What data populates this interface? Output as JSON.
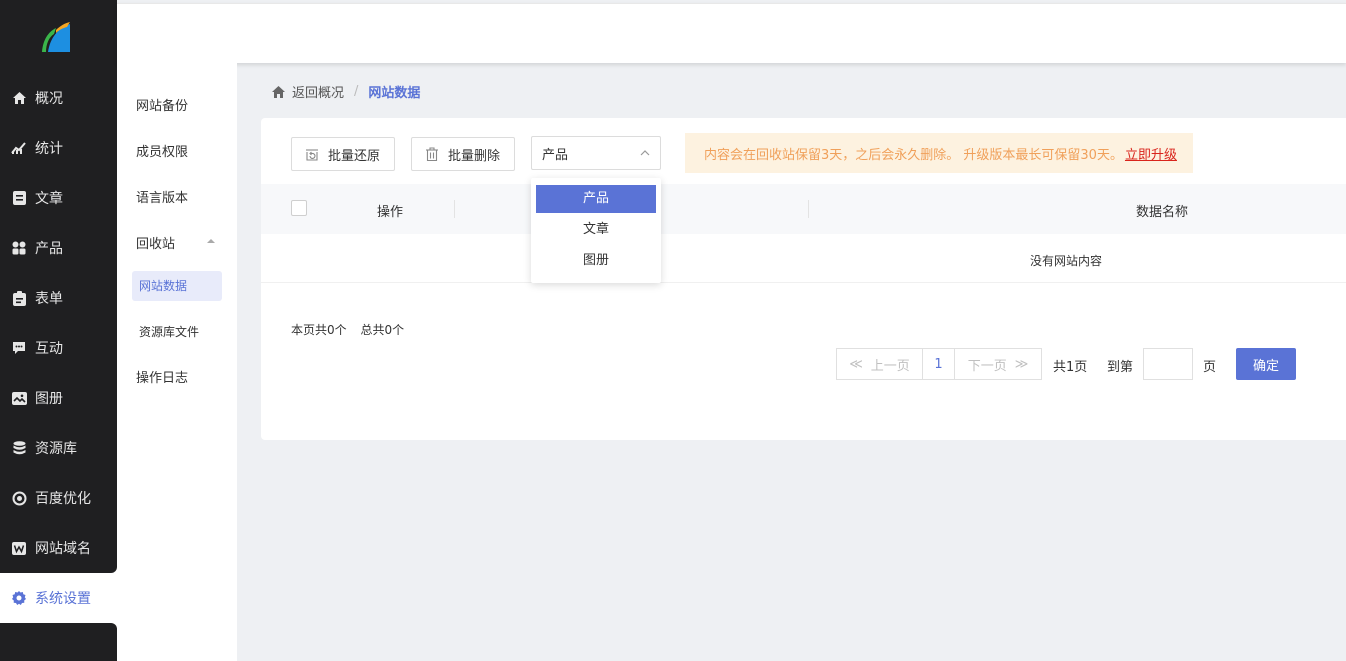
{
  "sidebar": {
    "items": [
      {
        "label": "概况",
        "icon": "home-icon"
      },
      {
        "label": "统计",
        "icon": "chart-icon"
      },
      {
        "label": "文章",
        "icon": "article-icon"
      },
      {
        "label": "产品",
        "icon": "grid-icon"
      },
      {
        "label": "表单",
        "icon": "clipboard-icon"
      },
      {
        "label": "互动",
        "icon": "chat-icon"
      },
      {
        "label": "图册",
        "icon": "image-icon"
      },
      {
        "label": "资源库",
        "icon": "database-icon"
      },
      {
        "label": "百度优化",
        "icon": "target-icon"
      },
      {
        "label": "网站域名",
        "icon": "w-icon"
      },
      {
        "label": "系统设置",
        "icon": "gear-icon",
        "active": true
      }
    ]
  },
  "subnav": {
    "items": [
      "网站备份",
      "成员权限",
      "语言版本",
      "回收站"
    ],
    "children": [
      "网站数据",
      "资源库文件"
    ],
    "last": "操作日志"
  },
  "breadcrumb": {
    "back": "返回概况",
    "sep": "/",
    "current": "网站数据"
  },
  "toolbar": {
    "restore_label": "批量还原",
    "delete_label": "批量删除",
    "select_value": "产品",
    "notice_text": "内容会在回收站保留3天，之后会永久删除。 升级版本最长可保留30天。",
    "notice_link": "立即升级"
  },
  "dropdown": {
    "options": [
      "产品",
      "文章",
      "图册"
    ],
    "selected": "产品"
  },
  "table": {
    "col_op": "操作",
    "col_name": "数据名称",
    "empty_text": "没有网站内容"
  },
  "pagination": {
    "page_count_text": "本页共0个",
    "total_text": "总共0个",
    "prev": "上一页",
    "current_page": "1",
    "next": "下一页",
    "total_pages": "共1页",
    "goto_label": "到第",
    "page_unit": "页",
    "goto_value": "",
    "confirm": "确定"
  },
  "colors": {
    "accent": "#5a73d6",
    "sidebar_bg": "#1f1f21",
    "notice_bg": "#fdf2e0",
    "notice_text": "#f0a05a",
    "link_red": "#d9241c"
  }
}
